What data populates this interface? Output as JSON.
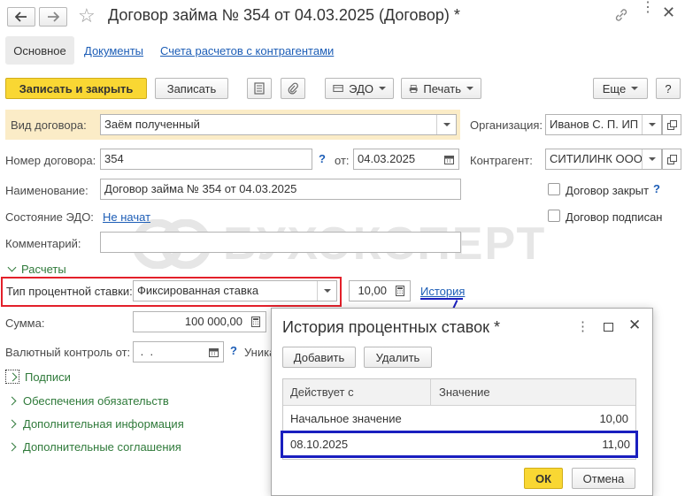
{
  "window": {
    "title": "Договор займа № 354 от 04.03.2025 (Договор) *"
  },
  "tabs": [
    {
      "label": "Основное"
    },
    {
      "label": "Документы"
    },
    {
      "label": "Счета расчетов с контрагентами"
    }
  ],
  "toolbar": {
    "save_close": "Записать и закрыть",
    "save": "Записать",
    "edo": "ЭДО",
    "print": "Печать",
    "more": "Еще",
    "help": "?"
  },
  "form": {
    "vid_label": "Вид договора:",
    "vid_value": "Заём полученный",
    "org_label": "Организация:",
    "org_value": "Иванов С. П. ИП",
    "number_label": "Номер договора:",
    "number_value": "354",
    "date_label": "от:",
    "date_value": "04.03.2025",
    "contr_label": "Контрагент:",
    "contr_value": "СИТИЛИНК ООО",
    "name_label": "Наименование:",
    "name_value": "Договор займа № 354 от 04.03.2025",
    "closed_label": "Договор закрыт",
    "edo_label": "Состояние ЭДО:",
    "edo_value": "Не начат",
    "signed_label": "Договор подписан",
    "comment_label": "Комментарий:",
    "comment_value": "",
    "help": "?"
  },
  "calc": {
    "section": "Расчеты",
    "rate_type_label": "Тип процентной ставки:",
    "rate_type_value": "Фиксированная ставка",
    "rate_value": "10,00",
    "history_link": "История",
    "sum_label": "Сумма:",
    "sum_value": "100 000,00",
    "currency_label": "Валютный контроль от:",
    "currency_value": " .  .",
    "cut_label": "Уника"
  },
  "sections": [
    "Подписи",
    "Обеспечения обязательств",
    "Дополнительная информация",
    "Дополнительные соглашения"
  ],
  "watermark": "БУХЭКСПЕРТ",
  "dialog": {
    "title": "История процентных ставок *",
    "add": "Добавить",
    "delete": "Удалить",
    "col1": "Действует с",
    "col2": "Значение",
    "rows": [
      {
        "date": "Начальное значение",
        "value": "10,00"
      },
      {
        "date": "08.10.2025",
        "value": "11,00"
      }
    ],
    "ok": "ОК",
    "cancel": "Отмена"
  },
  "colors": {
    "accent_yellow": "#f9d733",
    "highlight_red": "#e3202a",
    "highlight_blue": "#1a1fbf",
    "link_blue": "#1c5db6",
    "section_green": "#2f7a3a"
  }
}
